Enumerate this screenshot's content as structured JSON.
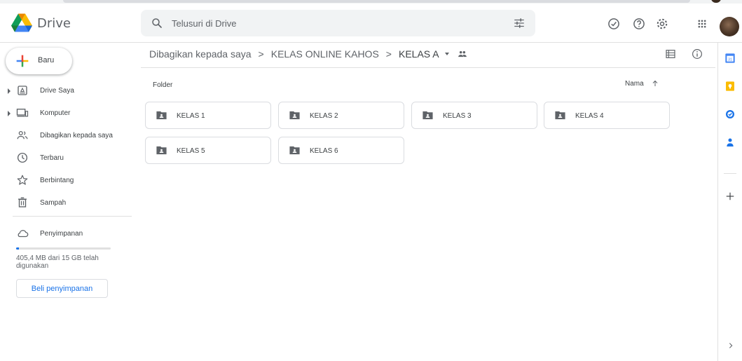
{
  "header": {
    "brand": "Drive",
    "search_placeholder": "Telusuri di Drive",
    "icons": [
      "offline-status-icon",
      "help-icon",
      "settings-icon",
      "apps-grid-icon"
    ]
  },
  "sidebar": {
    "new_label": "Baru",
    "items": [
      {
        "label": "Drive Saya",
        "icon": "my-drive-icon",
        "expandable": true
      },
      {
        "label": "Komputer",
        "icon": "computer-icon",
        "expandable": true
      },
      {
        "label": "Dibagikan kepada saya",
        "icon": "shared-with-me-icon",
        "expandable": false
      },
      {
        "label": "Terbaru",
        "icon": "clock-icon",
        "expandable": false
      },
      {
        "label": "Berbintang",
        "icon": "star-icon",
        "expandable": false
      },
      {
        "label": "Sampah",
        "icon": "trash-icon",
        "expandable": false
      }
    ],
    "storage": {
      "label": "Penyimpanan",
      "usage_text": "405,4 MB dari 15 GB telah digunakan",
      "used_fraction": 0.027,
      "buy_label": "Beli penyimpanan"
    }
  },
  "breadcrumb": {
    "items": [
      "Dibagikan kepada saya",
      "KELAS ONLINE KAHOS",
      "KELAS A"
    ],
    "separator": ">"
  },
  "main": {
    "section_label": "Folder",
    "sort_label": "Nama",
    "sort_direction": "ascending",
    "folders": [
      "KELAS 1",
      "KELAS 2",
      "KELAS 3",
      "KELAS 4",
      "KELAS 5",
      "KELAS 6"
    ]
  },
  "side_panel": {
    "apps": [
      "calendar-icon",
      "keep-icon",
      "tasks-icon",
      "contacts-icon"
    ]
  },
  "colors": {
    "accent": "#1a73e8",
    "folder_icon": "#5f6368",
    "border": "#dadce0"
  }
}
